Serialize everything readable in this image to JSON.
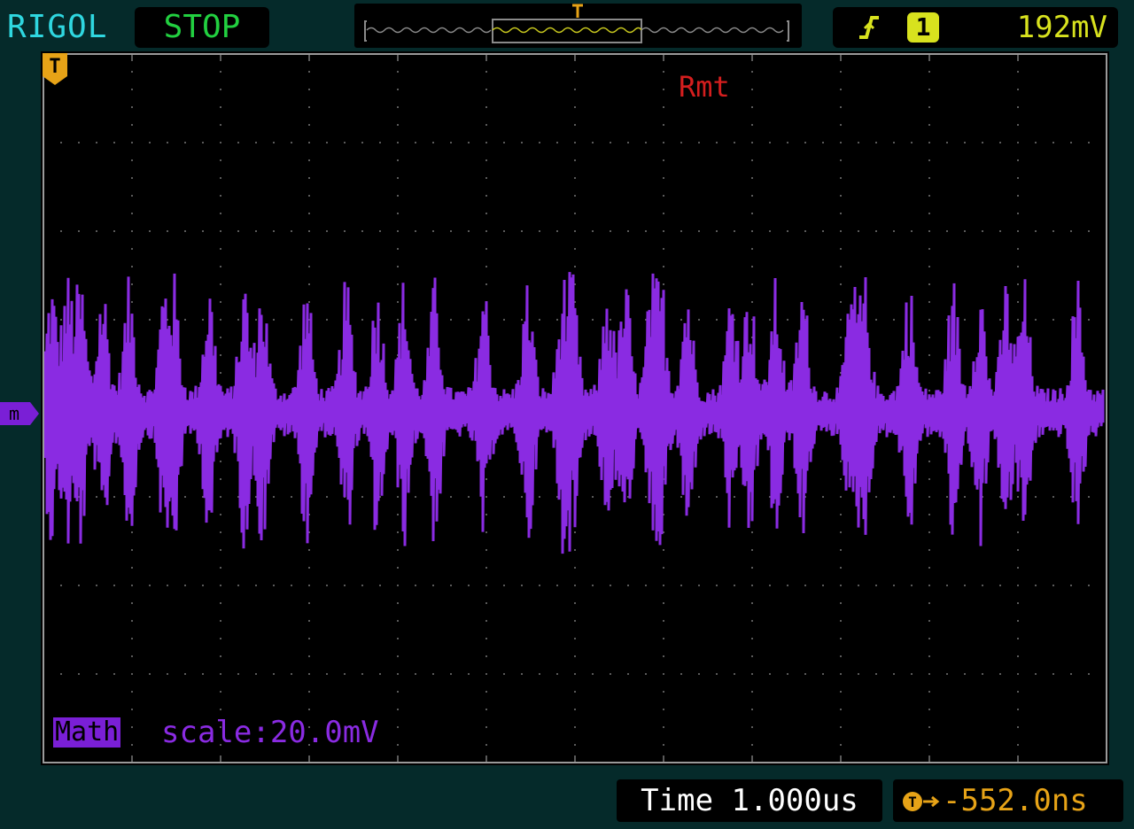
{
  "header": {
    "brand": "RIGOL",
    "run_state": "STOP",
    "trigger": {
      "edge_icon": "rising-edge-icon",
      "source": "1",
      "level": "192mV"
    }
  },
  "screen": {
    "trigger_mode": "Rmt",
    "math": {
      "label": "Math",
      "scale_text": "scale:20.0mV",
      "ref_marker": "m"
    }
  },
  "footer": {
    "time_base": "Time 1.000us",
    "trigger_offset": "-552.0ns"
  },
  "colors": {
    "brand": "#2fd7e0",
    "run_state": "#22d040",
    "trigger": "#d8e21e",
    "math_trace": "#8a2be2",
    "trigger_mode": "#d41e1e",
    "time_offset": "#e7a317",
    "grid": "#5a5a5a"
  }
}
